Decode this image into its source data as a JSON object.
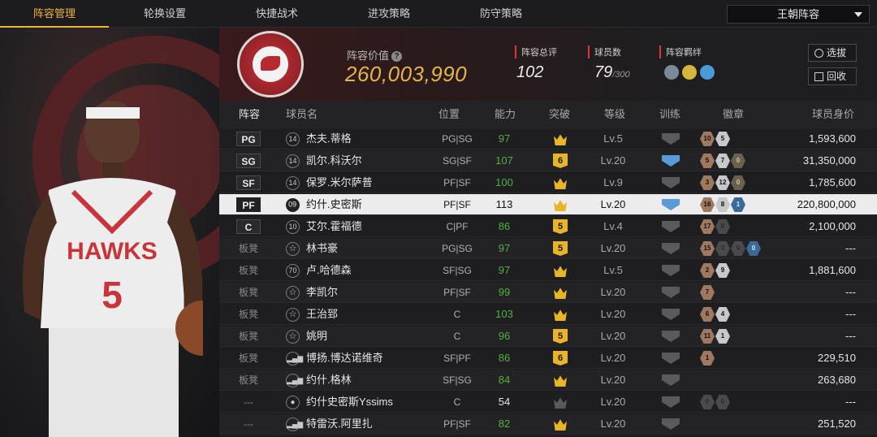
{
  "tabs": [
    {
      "label": "阵容管理",
      "active": true
    },
    {
      "label": "轮换设置",
      "active": false
    },
    {
      "label": "快捷战术",
      "active": false
    },
    {
      "label": "进攻策略",
      "active": false
    },
    {
      "label": "防守策略",
      "active": false
    }
  ],
  "lineup_selector": {
    "value": "王朝阵容"
  },
  "summary": {
    "value_label": "阵容价值",
    "value": "260,003,990",
    "rating_label": "阵容总评",
    "rating": "102",
    "count_label": "球员数",
    "count": "79",
    "count_max": "/300",
    "bond_label": "阵容羁绊",
    "btn_scout": "选拔",
    "btn_recycle": "回收"
  },
  "table": {
    "headers": [
      "阵容",
      "球员名",
      "位置",
      "能力",
      "突破",
      "等级",
      "训练",
      "徽章",
      "球员身价"
    ],
    "rows": [
      {
        "slot": "PG",
        "starter": true,
        "num": "14",
        "icon": "jersey",
        "name": "杰夫.蒂格",
        "pos": "PG|SG",
        "ability": "97",
        "ability_white": false,
        "break_type": "crown",
        "level": "Lv.5",
        "train": "gray",
        "badges": [
          [
            "bronze",
            "10"
          ],
          [
            "silver",
            "5"
          ]
        ],
        "price": "1,593,600"
      },
      {
        "slot": "SG",
        "starter": true,
        "num": "14",
        "icon": "jersey",
        "name": "凯尔.科沃尔",
        "pos": "SG|SF",
        "ability": "107",
        "ability_white": false,
        "break_type": "6",
        "level": "Lv.20",
        "train": "blue",
        "badges": [
          [
            "bronze",
            "5"
          ],
          [
            "silver",
            "7"
          ],
          [
            "gold",
            "0"
          ]
        ],
        "price": "31,350,000"
      },
      {
        "slot": "SF",
        "starter": true,
        "num": "14",
        "icon": "jersey",
        "name": "保罗.米尔萨普",
        "pos": "PF|SF",
        "ability": "100",
        "ability_white": false,
        "break_type": "crown",
        "level": "Lv.9",
        "train": "gray",
        "badges": [
          [
            "bronze",
            "3"
          ],
          [
            "silver",
            "12"
          ],
          [
            "gold",
            "0"
          ]
        ],
        "price": "1,785,600"
      },
      {
        "slot": "PF",
        "starter": true,
        "num": "09",
        "icon": "jersey",
        "name": "约什.史密斯",
        "pos": "PF|SF",
        "ability": "113",
        "ability_white": true,
        "break_type": "crown",
        "level": "Lv.20",
        "train": "blue",
        "badges": [
          [
            "bronze",
            "16"
          ],
          [
            "silver",
            "8"
          ],
          [
            "blue",
            "1"
          ]
        ],
        "price": "220,800,000",
        "selected": true
      },
      {
        "slot": "C",
        "starter": true,
        "num": "10",
        "icon": "jersey",
        "name": "艾尔.霍福德",
        "pos": "C|PF",
        "ability": "86",
        "ability_white": false,
        "break_type": "5",
        "level": "Lv.4",
        "train": "gray",
        "badges": [
          [
            "bronze",
            "17"
          ],
          [
            "dark",
            "0"
          ]
        ],
        "price": "2,100,000"
      },
      {
        "slot": "板凳",
        "starter": false,
        "num": "",
        "icon": "star",
        "name": "林书豪",
        "pos": "PG|SG",
        "ability": "97",
        "ability_white": false,
        "break_type": "5",
        "level": "Lv.20",
        "train": "gray",
        "badges": [
          [
            "bronze",
            "15"
          ],
          [
            "dark",
            "0"
          ],
          [
            "dark",
            "0"
          ],
          [
            "blue",
            "0"
          ]
        ],
        "price": "---"
      },
      {
        "slot": "板凳",
        "starter": false,
        "num": "70",
        "icon": "jersey",
        "name": "卢.哈德森",
        "pos": "SF|SG",
        "ability": "97",
        "ability_white": false,
        "break_type": "crown",
        "level": "Lv.5",
        "train": "gray",
        "badges": [
          [
            "bronze",
            "2"
          ],
          [
            "silver",
            "9"
          ]
        ],
        "price": "1,881,600"
      },
      {
        "slot": "板凳",
        "starter": false,
        "num": "",
        "icon": "star",
        "name": "李凯尔",
        "pos": "PF|SF",
        "ability": "99",
        "ability_white": false,
        "break_type": "crown",
        "level": "Lv.20",
        "train": "gray",
        "badges": [
          [
            "bronze",
            "7"
          ]
        ],
        "price": "---"
      },
      {
        "slot": "板凳",
        "starter": false,
        "num": "",
        "icon": "star",
        "name": "王治郅",
        "pos": "C",
        "ability": "103",
        "ability_white": false,
        "break_type": "crown",
        "level": "Lv.20",
        "train": "gray",
        "badges": [
          [
            "bronze",
            "6"
          ],
          [
            "silver",
            "4"
          ]
        ],
        "price": "---"
      },
      {
        "slot": "板凳",
        "starter": false,
        "num": "",
        "icon": "star",
        "name": "姚明",
        "pos": "C",
        "ability": "96",
        "ability_white": false,
        "break_type": "5",
        "level": "Lv.20",
        "train": "gray",
        "badges": [
          [
            "bronze",
            "11"
          ],
          [
            "silver",
            "1"
          ]
        ],
        "price": "---"
      },
      {
        "slot": "板凳",
        "starter": false,
        "num": "",
        "icon": "bars",
        "name": "博扬.博达诺维奇",
        "pos": "SF|PF",
        "ability": "86",
        "ability_white": false,
        "break_type": "6",
        "level": "Lv.20",
        "train": "gray",
        "badges": [
          [
            "bronze",
            "1"
          ]
        ],
        "price": "229,510"
      },
      {
        "slot": "板凳",
        "starter": false,
        "num": "",
        "icon": "bars",
        "name": "约什.格林",
        "pos": "SF|SG",
        "ability": "84",
        "ability_white": false,
        "break_type": "crown",
        "level": "Lv.20",
        "train": "gray",
        "badges": [],
        "price": "263,680"
      },
      {
        "slot": "---",
        "starter": false,
        "num": "",
        "icon": "person",
        "name": "约什史密斯Yssims",
        "pos": "C",
        "ability": "54",
        "ability_white": true,
        "break_type": "crown-gray",
        "level": "Lv.20",
        "train": "gray",
        "badges": [
          [
            "dark",
            "0"
          ],
          [
            "dark",
            "0"
          ]
        ],
        "price": "---"
      },
      {
        "slot": "---",
        "starter": false,
        "num": "",
        "icon": "bars",
        "name": "特雷沃.阿里扎",
        "pos": "PF|SF",
        "ability": "82",
        "ability_white": false,
        "break_type": "crown",
        "level": "Lv.20",
        "train": "gray",
        "badges": [],
        "price": "251,520"
      }
    ]
  },
  "colors": {
    "accent": "#f0b23a",
    "ability_green": "#52b040",
    "team_red": "#c8343a"
  }
}
